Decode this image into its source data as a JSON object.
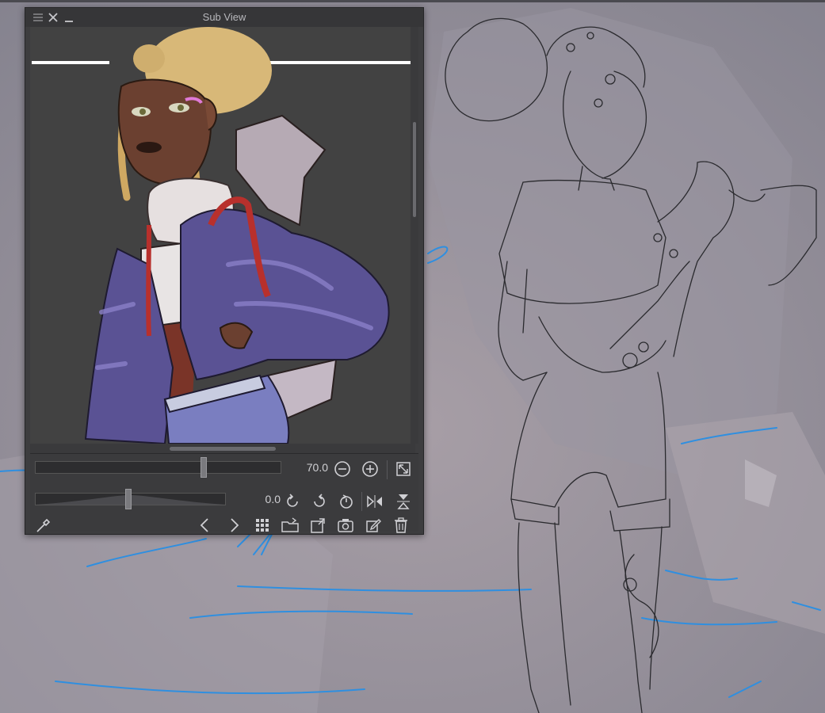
{
  "window": {
    "title": "Sub View"
  },
  "zoom": {
    "value": "70.0",
    "level": 0.69
  },
  "rotation": {
    "value": "0.0",
    "level": 0.49
  },
  "colors": {
    "panel_bg": "#3d3d3f",
    "viewport_bg": "#424242",
    "jacket": "#5a5294",
    "skin": "#6b4030",
    "hair": "#d8b878",
    "sketch_bg": "#8e8c95",
    "blue_strokes": "#2f8fe0"
  },
  "icons": {
    "menu": "menu-icon",
    "close": "close-icon",
    "minimize": "minimize-icon",
    "zoom_out": "zoom-out-icon",
    "zoom_in": "zoom-in-icon",
    "fit": "fit-to-view-icon",
    "rotate_left": "rotate-left-icon",
    "rotate_right": "rotate-right-icon",
    "reset_rotation": "reset-rotation-icon",
    "flip_h": "flip-horizontal-icon",
    "flip_v": "flip-vertical-icon",
    "eyedropper": "eyedropper-icon",
    "prev": "previous-image-icon",
    "next": "next-image-icon",
    "grid": "image-list-icon",
    "import": "import-image-icon",
    "open_dialog": "open-image-icon",
    "capture": "capture-canvas-icon",
    "edit": "edit-image-icon",
    "trash": "delete-image-icon"
  }
}
